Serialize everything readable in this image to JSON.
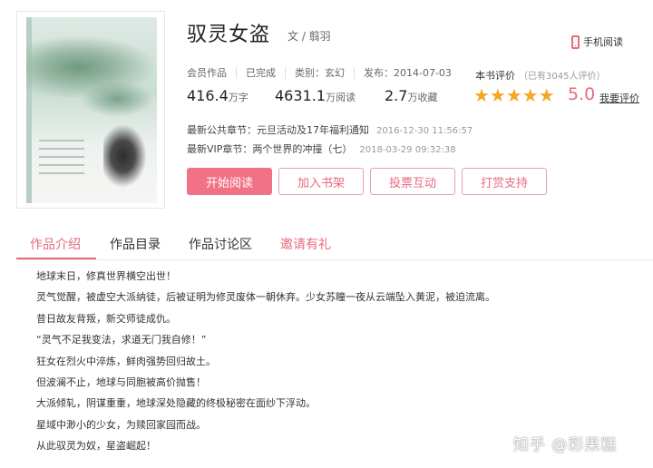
{
  "book": {
    "title": "驭灵女盗",
    "author": "文 / 翦羽",
    "mobile_read": "手机阅读",
    "meta": [
      "会员作品",
      "已完成",
      "类别：玄幻",
      "发布：2014-07-03"
    ],
    "rating_label": "本书评价",
    "rating_count": "（已有3045人评价）",
    "words": "416.4",
    "words_unit": "万字",
    "reads": "4631.1",
    "reads_unit": "万阅读",
    "favorites": "2.7",
    "favorites_unit": "万收藏",
    "stars": "★★★★★",
    "star_rating": 5,
    "score": "5.0",
    "my_rate": "我要评价",
    "latest_public_label": "最新公共章节：",
    "latest_public_title": "元旦活动及17年福利通知",
    "latest_public_time": "2016-12-30 11:56:57",
    "latest_vip_label": "最新VIP章节：",
    "latest_vip_title": "两个世界的冲撞（七）",
    "latest_vip_time": "2018-03-29 09:32:38"
  },
  "actions": {
    "start_reading": "开始阅读",
    "add_shelf": "加入书架",
    "vote": "投票互动",
    "tip": "打赏支持"
  },
  "tabs": [
    "作品介绍",
    "作品目录",
    "作品讨论区",
    "邀请有礼"
  ],
  "synopsis": [
    "地球末日，修真世界横空出世！",
    "灵气觉醒，被虚空大派纳徒，后被证明为修灵废体一朝休弃。少女苏瞳一夜从云端坠入黄泥，被迫流离。",
    "昔日故友背叛，新交师徒成仇。",
    "“灵气不足我变法，求道无门我自修！”",
    "狂女在烈火中淬炼，鲜肉强势回归故土。",
    "但波澜不止，地球与同胞被高价抛售！",
    "大派倾轧，阴谋重重，地球深处隐藏的终极秘密在面纱下浮动。",
    "星域中渺小的少女，为赎回家园而战。",
    "从此驭灵为奴，星盗崛起！"
  ],
  "watermark": "知乎 @彩果糕",
  "colors": {
    "accent": "#e86a7d",
    "star": "#f5a623"
  }
}
